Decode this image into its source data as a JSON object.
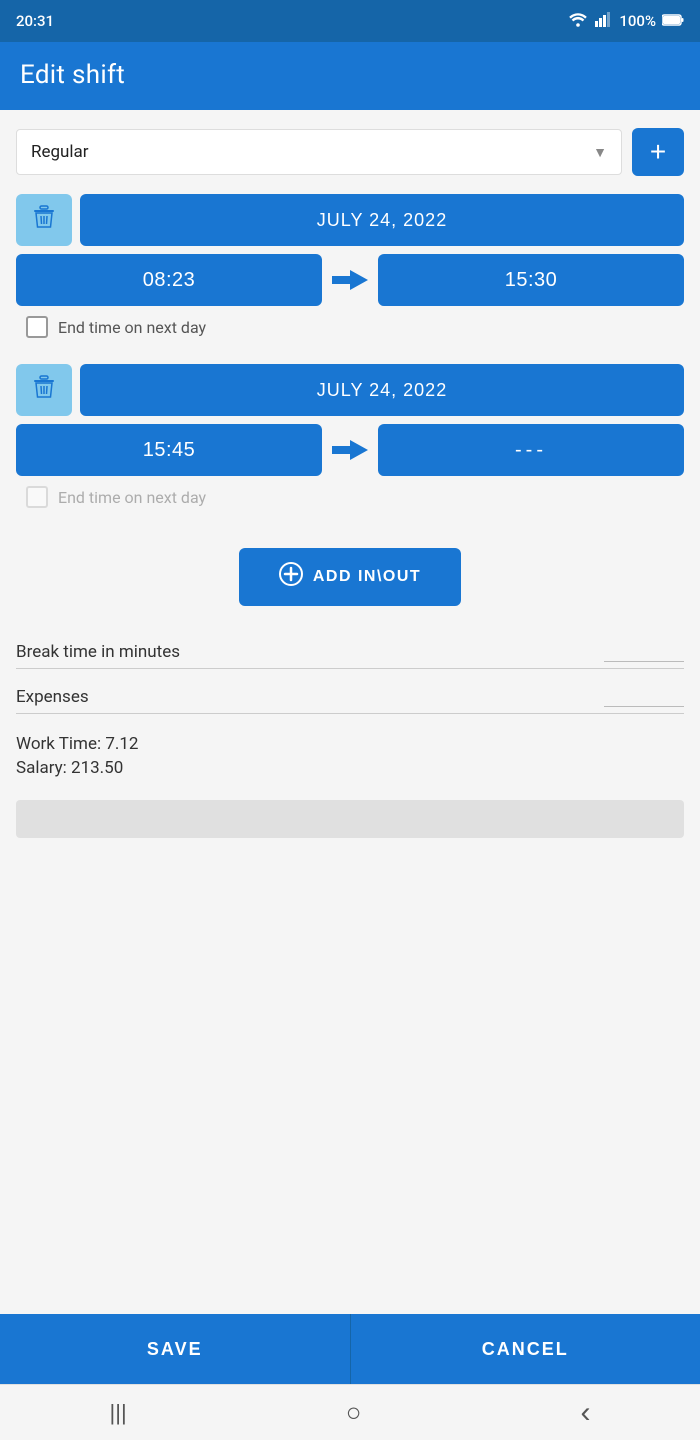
{
  "statusBar": {
    "time": "20:31",
    "battery": "100%"
  },
  "header": {
    "title": "Edit shift"
  },
  "shiftType": {
    "label": "Regular",
    "addButtonLabel": "+"
  },
  "shift1": {
    "date": "JULY 24, 2022",
    "startTime": "08:23",
    "endTime": "15:30",
    "nextDayLabel": "End time on next day",
    "nextDayChecked": false,
    "nextDayDisabled": false
  },
  "shift2": {
    "date": "JULY 24, 2022",
    "startTime": "15:45",
    "endTime": "---",
    "nextDayLabel": "End time on next day",
    "nextDayChecked": false,
    "nextDayDisabled": true
  },
  "addInOut": {
    "label": "ADD IN\\OUT"
  },
  "breakTime": {
    "label": "Break time in minutes",
    "value": ""
  },
  "expenses": {
    "label": "Expenses",
    "value": ""
  },
  "summary": {
    "workTime": "Work Time: 7.12",
    "salary": "Salary: 213.50"
  },
  "buttons": {
    "save": "SAVE",
    "cancel": "CANCEL"
  },
  "nav": {
    "menu": "|||",
    "home": "○",
    "back": "‹"
  }
}
